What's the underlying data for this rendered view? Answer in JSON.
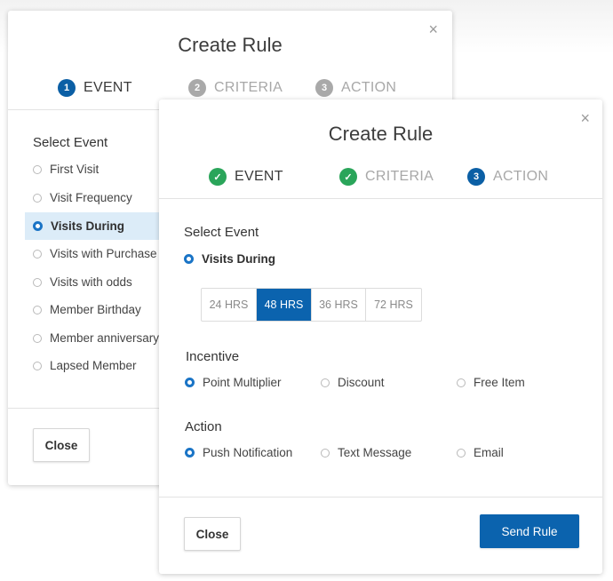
{
  "back_modal": {
    "title": "Create Rule",
    "close_glyph": "×",
    "steps": [
      {
        "number": "1",
        "label": "EVENT",
        "state": "active"
      },
      {
        "number": "2",
        "label": "CRITERIA",
        "state": "inactive"
      },
      {
        "number": "3",
        "label": "ACTION",
        "state": "inactive"
      }
    ],
    "section_title": "Select Event",
    "events": [
      {
        "label": "First Visit",
        "selected": false
      },
      {
        "label": "Visit Frequency",
        "selected": false
      },
      {
        "label": "Visits During",
        "selected": true
      },
      {
        "label": "Visits with Purchase",
        "selected": false
      },
      {
        "label": "Visits with odds",
        "selected": false
      },
      {
        "label": "Member Birthday",
        "selected": false
      },
      {
        "label": "Member anniversary",
        "selected": false
      },
      {
        "label": "Lapsed Member",
        "selected": false
      }
    ],
    "close_button": "Close"
  },
  "front_modal": {
    "title": "Create Rule",
    "close_glyph": "×",
    "steps": [
      {
        "number": "✓",
        "label": "EVENT",
        "state": "done",
        "label_state": "active"
      },
      {
        "number": "✓",
        "label": "CRITERIA",
        "state": "done",
        "label_state": "inactive"
      },
      {
        "number": "3",
        "label": "ACTION",
        "state": "active",
        "label_state": "inactive"
      }
    ],
    "select_event": {
      "title": "Select Event",
      "selected_label": "Visits During"
    },
    "durations": {
      "options": [
        "24 HRS",
        "48 HRS",
        "36 HRS",
        "72 HRS"
      ],
      "selected": "48 HRS"
    },
    "incentive": {
      "title": "Incentive",
      "options": [
        {
          "label": "Point Multiplier",
          "selected": true
        },
        {
          "label": "Discount",
          "selected": false
        },
        {
          "label": "Free Item",
          "selected": false
        }
      ]
    },
    "action": {
      "title": "Action",
      "options": [
        {
          "label": "Push Notification",
          "selected": true
        },
        {
          "label": "Text Message",
          "selected": false
        },
        {
          "label": "Email",
          "selected": false
        }
      ]
    },
    "close_button": "Close",
    "send_button": "Send Rule"
  },
  "colors": {
    "primary": "#0b63ae",
    "success": "#2aa55a",
    "highlight": "#dcecf8"
  }
}
